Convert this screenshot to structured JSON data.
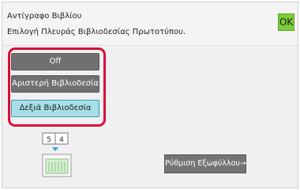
{
  "header": {
    "title": "Αντίγραφο Βιβλίου",
    "subtitle": "Επιλογή Πλευράς Βιβλιοδεσίας Πρωτοτύπου.",
    "ok_label": "OK"
  },
  "options": [
    {
      "label": "Off",
      "state": "normal"
    },
    {
      "label": "Αριστερή Βιβλιοδεσία",
      "state": "normal"
    },
    {
      "label": "Δεξιά Βιβλιοδεσία",
      "state": "selected"
    }
  ],
  "illustration": {
    "page_numbers": [
      "5",
      "4"
    ],
    "icon": "book-binding-icon"
  },
  "cover_button": {
    "label": "Ρύθμιση Εξωφύλλου",
    "arrow": "→"
  },
  "colors": {
    "accent_ok": "#7ccd37",
    "highlight_border": "#d80e3a",
    "selected_option": "#a7dfe7",
    "option_dark": "#707070"
  }
}
